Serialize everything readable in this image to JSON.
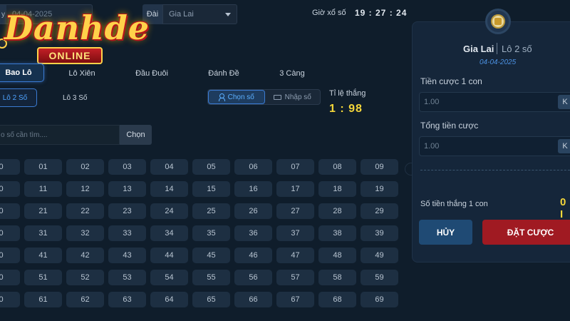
{
  "header": {
    "date_label": "y",
    "date_value": "04-04-2025",
    "station_label": "Đài",
    "station_value": "Gia Lai",
    "draw_time_label": "Giờ xổ số",
    "draw_time": "19 : 27 : 24"
  },
  "logo": {
    "main": "Danhde",
    "sub": "ONLINE"
  },
  "bet_tabs": [
    "Bao Lô",
    "Lô Xiên",
    "Đầu Đuôi",
    "Đánh Đề",
    "3 Càng"
  ],
  "sub_tabs": [
    "Lô 2 Số",
    "Lô 3 Số"
  ],
  "modes": [
    "Chọn số",
    "Nhập số"
  ],
  "rate": {
    "label": "Tỉ lệ thắng",
    "value": "1 : 98"
  },
  "search": {
    "placeholder": "o số cần tìm....",
    "button": "Chọn"
  },
  "numbers": [
    [
      "0",
      "01",
      "02",
      "03",
      "04",
      "05",
      "06",
      "07",
      "08",
      "09"
    ],
    [
      "0",
      "11",
      "12",
      "13",
      "14",
      "15",
      "16",
      "17",
      "18",
      "19"
    ],
    [
      "0",
      "21",
      "22",
      "23",
      "24",
      "25",
      "26",
      "27",
      "28",
      "29"
    ],
    [
      "0",
      "31",
      "32",
      "33",
      "34",
      "35",
      "36",
      "37",
      "38",
      "39"
    ],
    [
      "0",
      "41",
      "42",
      "43",
      "44",
      "45",
      "46",
      "47",
      "48",
      "49"
    ],
    [
      "0",
      "51",
      "52",
      "53",
      "54",
      "55",
      "56",
      "57",
      "58",
      "59"
    ],
    [
      "0",
      "61",
      "62",
      "63",
      "64",
      "65",
      "66",
      "67",
      "68",
      "69"
    ]
  ],
  "panel": {
    "station": "Gia Lai",
    "bet_type": "Lô 2 số",
    "date": "04-04-2025",
    "stake_label": "Tiền cược 1 con",
    "stake_value": "1.00",
    "stake_unit": "K",
    "total_label": "Tổng tiền cược",
    "total_value": "1.00",
    "total_unit": "K",
    "win_label": "Số tiền thắng 1 con",
    "win_value": "0 I",
    "cancel": "HỦY",
    "place_bet": "ĐẶT CƯỢC"
  },
  "colors": {
    "background": "#0f1d2b",
    "accent_blue": "#3b7bd3",
    "gold": "#f5d73a",
    "bet_red": "#a01a22"
  }
}
